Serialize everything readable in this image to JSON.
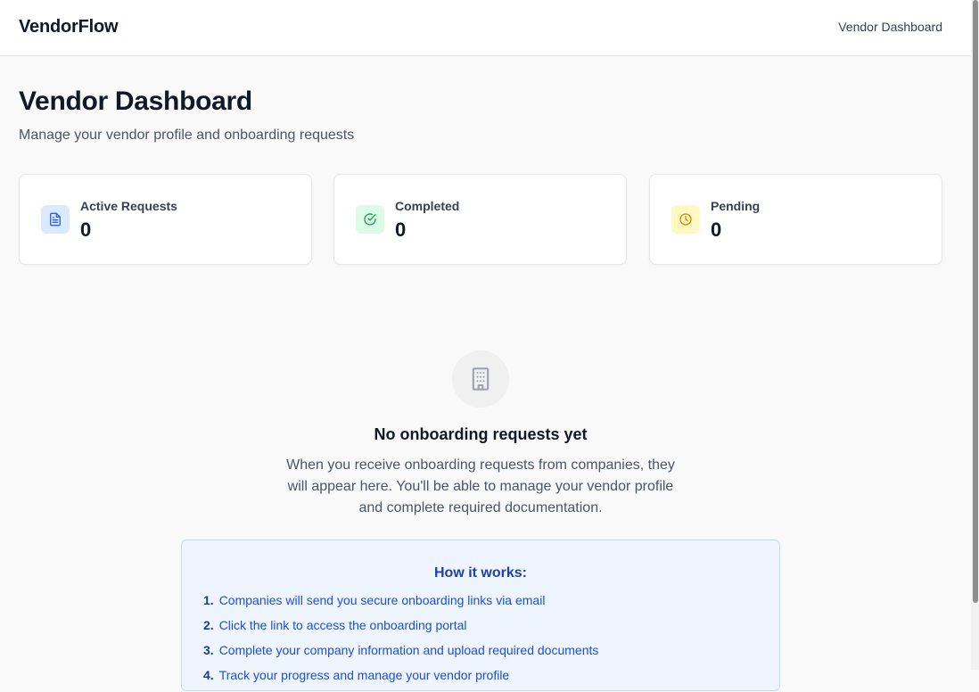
{
  "header": {
    "brand": "VendorFlow",
    "nav_link": "Vendor Dashboard"
  },
  "page": {
    "title": "Vendor Dashboard",
    "subtitle": "Manage your vendor profile and onboarding requests"
  },
  "stats": [
    {
      "label": "Active Requests",
      "value": "0",
      "icon": "document-icon",
      "color": "#2563eb",
      "bg": "#dbeafe"
    },
    {
      "label": "Completed",
      "value": "0",
      "icon": "check-circle-icon",
      "color": "#16a34a",
      "bg": "#dcfce7"
    },
    {
      "label": "Pending",
      "value": "0",
      "icon": "clock-icon",
      "color": "#ca8a04",
      "bg": "#fef9c3"
    }
  ],
  "empty_state": {
    "icon": "building-icon",
    "title": "No onboarding requests yet",
    "description": "When you receive onboarding requests from companies, they will appear here. You'll be able to manage your vendor profile and complete required documentation."
  },
  "how_it_works": {
    "title": "How it works:",
    "steps": [
      {
        "num": "1.",
        "text": "Companies will send you secure onboarding links via email"
      },
      {
        "num": "2.",
        "text": "Click the link to access the onboarding portal"
      },
      {
        "num": "3.",
        "text": "Complete your company information and upload required documents"
      },
      {
        "num": "4.",
        "text": "Track your progress and manage your vendor profile"
      }
    ]
  }
}
